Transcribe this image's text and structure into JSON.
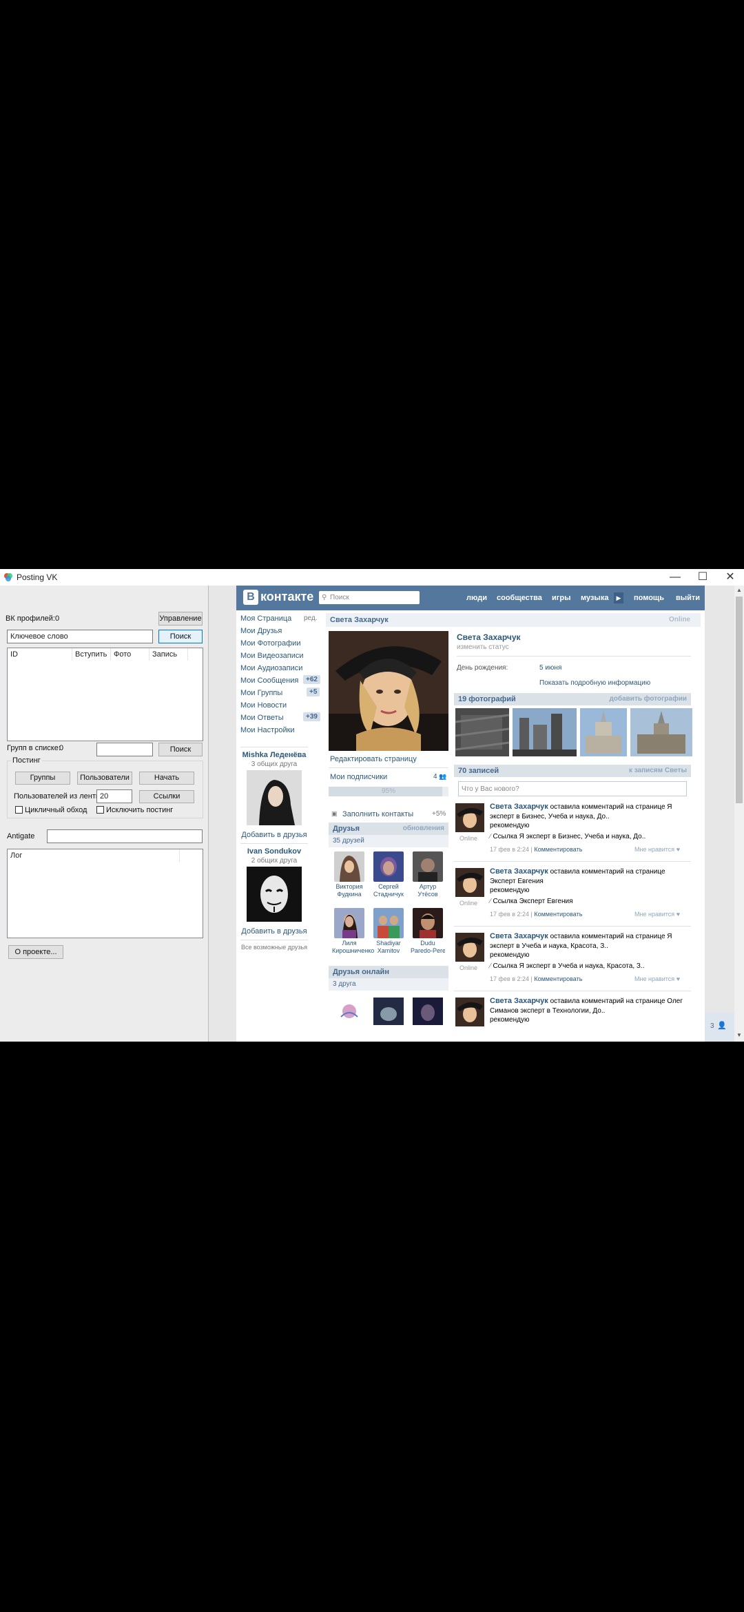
{
  "window": {
    "title": "Posting VK",
    "controls": {
      "minimize": "—",
      "maximize": "☐",
      "close": "✕"
    }
  },
  "left_panel": {
    "vk_profiles_label": "ВК профилей:",
    "vk_profiles_count": "0",
    "manage_button": "Управление",
    "keyword_value": "Ключевое слово",
    "search_button": "Поиск",
    "table_headers": [
      "ID",
      "Вступить",
      "Фото",
      "Запись"
    ],
    "groups_in_list_label": "Групп в списке:",
    "groups_in_list_count": "0",
    "search_button_2": "Поиск",
    "posting_group_label": "Постинг",
    "groups_button": "Группы",
    "users_button": "Пользователи",
    "start_button": "Начать",
    "users_from_feed_label": "Пользователей из ленты:",
    "users_from_feed_value": "20",
    "links_button": "Ссылки",
    "cyclic_label": "Цикличный обход",
    "exclude_posting_label": "Исключить постинг",
    "antigate_label": "Antigate",
    "log_header": "Лог",
    "about_button": "О проекте..."
  },
  "vk": {
    "logo_text": "контакте",
    "logo_letter": "В",
    "search_placeholder": "Поиск",
    "nav": [
      "люди",
      "сообщества",
      "игры",
      "музыка",
      "помощь",
      "выйти"
    ],
    "menu": [
      {
        "label": "Моя Страница",
        "extra": "ред."
      },
      {
        "label": "Мои Друзья",
        "extra": ""
      },
      {
        "label": "Мои Фотографии",
        "extra": ""
      },
      {
        "label": "Мои Видеозаписи",
        "extra": ""
      },
      {
        "label": "Мои Аудиозаписи",
        "extra": ""
      },
      {
        "label": "Мои Сообщения",
        "extra": "+62"
      },
      {
        "label": "Мои Группы",
        "extra": "+5"
      },
      {
        "label": "Мои Новости",
        "extra": ""
      },
      {
        "label": "Мои Ответы",
        "extra": "+39"
      },
      {
        "label": "Мои Настройки",
        "extra": ""
      }
    ],
    "suggest": [
      {
        "name": "Mishka Леденёва",
        "common": "3 общих друга",
        "add": "Добавить в друзья"
      },
      {
        "name": "Ivan Sondukov",
        "common": "2 общих друга",
        "add": "Добавить в друзья"
      }
    ],
    "all_possible_friends": "Все возможные друзья",
    "profile_header_name": "Света Захарчук",
    "profile_header_status": "Online",
    "edit_page": "Редактировать страницу",
    "my_subscribers": "Мои подписчики",
    "subscribers_count": "4",
    "progress_text": "95%",
    "progress_value": 0.95,
    "fill_contacts": "Заполнить контакты",
    "fill_contacts_bonus": "+5%",
    "friends_title": "Друзья",
    "friends_updates": "обновления",
    "friends_count": "35 друзей",
    "friends": [
      {
        "first": "Виктория",
        "last": "Фудкина"
      },
      {
        "first": "Сергей",
        "last": "Стадничук"
      },
      {
        "first": "Артур",
        "last": "Утёсов"
      },
      {
        "first": "Лиля",
        "last": "Кирошниченко"
      },
      {
        "first": "Shadiyar",
        "last": "Xamitov"
      },
      {
        "first": "Dudu",
        "last": "Paredo-Pereira-Ro"
      }
    ],
    "friends_online_title": "Друзья онлайн",
    "friends_online_count": "3 друга",
    "name": "Света Захарчук",
    "change_status": "изменить статус",
    "birthday_label": "День рождения:",
    "birthday_value": "5 июня",
    "show_details": "Показать подробную информацию",
    "photos_title": "19 фотографий",
    "add_photos": "добавить фотографии",
    "wall_title": "70 записей",
    "wall_filter": "к записям Светы",
    "whats_new_placeholder": "Что у Вас нового?",
    "posts": [
      {
        "name": "Света Захарчук",
        "action": "оставила комментарий на странице Я эксперт в Бизнес, Учеба и наука, До..",
        "line2": "рекомендую",
        "link": "Ссылка Я эксперт в Бизнес, Учеба и наука, До..",
        "online": "Online",
        "date": "17 фев в 2:24",
        "comment": "Комментировать",
        "like": "Мне нравится"
      },
      {
        "name": "Света Захарчук",
        "action": "оставила комментарий на странице Эксперт Евгения",
        "line2": "рекомендую",
        "link": "Ссылка Эксперт Евгения",
        "online": "Online",
        "date": "17 фев в 2:24",
        "comment": "Комментировать",
        "like": "Мне нравится"
      },
      {
        "name": "Света Захарчук",
        "action": "оставила комментарий на странице Я эксперт в Учеба и наука, Красота, З..",
        "line2": "рекомендую",
        "link": "Ссылка Я эксперт в Учеба и наука, Красота, З..",
        "online": "Online",
        "date": "17 фев в 2:24",
        "comment": "Комментировать",
        "like": "Мне нравится"
      },
      {
        "name": "Света Захарчук",
        "action": "оставила комментарий на странице Олег Симанов эксперт в Технологии, До..",
        "line2": "рекомендую",
        "link": "",
        "online": "",
        "date": "",
        "comment": "",
        "like": ""
      }
    ],
    "chat_count": "3"
  }
}
